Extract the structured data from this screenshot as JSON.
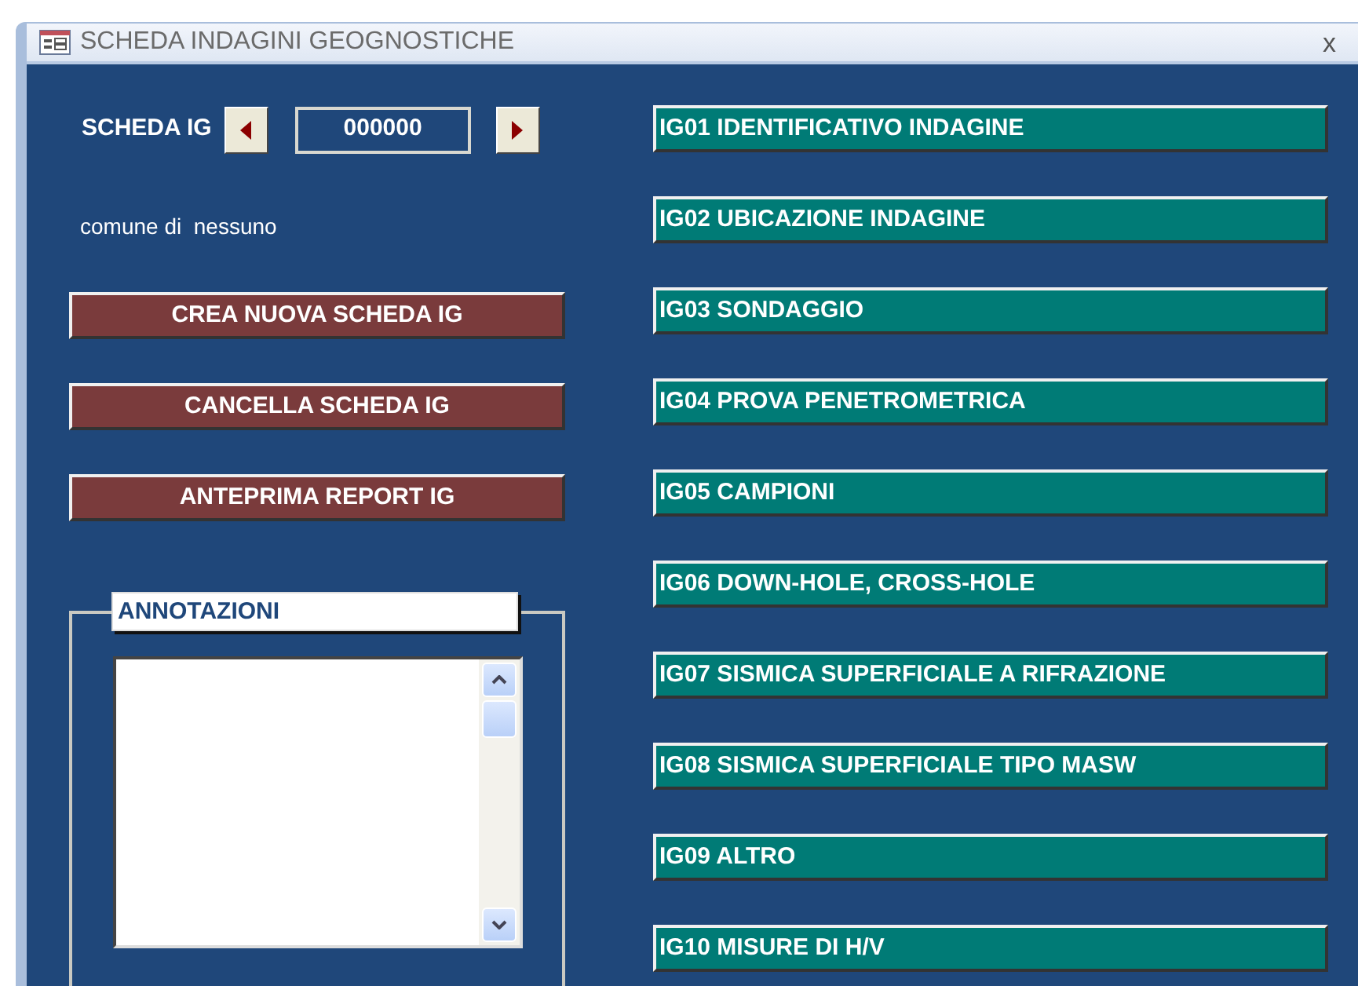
{
  "window": {
    "title": "SCHEDA INDAGINI GEOGNOSTICHE",
    "close": "x"
  },
  "record": {
    "label": "SCHEDA IG",
    "value": "000000"
  },
  "comune": "comune di  nessuno",
  "actions": [
    "CREA NUOVA SCHEDA IG",
    "CANCELLA SCHEDA IG",
    "ANTEPRIMA REPORT IG"
  ],
  "notes": {
    "label": "ANNOTAZIONI"
  },
  "sections": [
    "IG01 IDENTIFICATIVO INDAGINE",
    "IG02 UBICAZIONE INDAGINE",
    "IG03 SONDAGGIO",
    "IG04 PROVA PENETROMETRICA",
    "IG05 CAMPIONI",
    "IG06 DOWN-HOLE, CROSS-HOLE",
    "IG07 SISMICA SUPERFICIALE A RIFRAZIONE",
    "IG08 SISMICA SUPERFICIALE TIPO MASW",
    "IG09 ALTRO",
    "IG10 MISURE DI H/V"
  ]
}
